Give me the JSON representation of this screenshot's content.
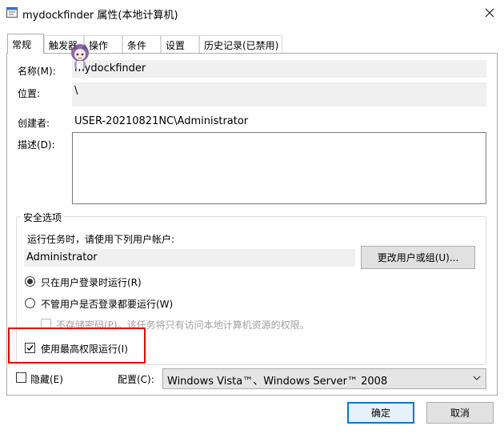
{
  "window": {
    "title": "mydockfinder 属性(本地计算机)",
    "close_glyph": "✕"
  },
  "tabs": [
    {
      "label": "常规",
      "active": true
    },
    {
      "label": "触发器",
      "active": false
    },
    {
      "label": "操作",
      "active": false
    },
    {
      "label": "条件",
      "active": false
    },
    {
      "label": "设置",
      "active": false
    },
    {
      "label": "历史记录(已禁用)",
      "active": false
    }
  ],
  "general": {
    "name_label": "名称(M):",
    "name_value": "mydockfinder",
    "location_label": "位置:",
    "location_value": "\\",
    "author_label": "创建者:",
    "author_value": "USER-20210821NC\\Administrator",
    "description_label": "描述(D):",
    "description_value": ""
  },
  "security": {
    "group_title": "安全选项",
    "run_as_label": "运行任务时，请使用下列用户帐户:",
    "user_account": "Administrator",
    "change_user_button": "更改用户或组(U)...",
    "radio_logged_on": "只在用户登录时运行(R)",
    "radio_logged_on_selected": true,
    "radio_whether_logged": "不管用户是否登录都要运行(W)",
    "radio_whether_logged_selected": false,
    "no_store_password": "不存储密码(P)。该任务将只有访问本地计算机资源的权限。",
    "highest_privileges": "使用最高权限运行(I)",
    "highest_privileges_checked": true
  },
  "bottom": {
    "hidden_label": "隐藏(E)",
    "hidden_checked": false,
    "configure_label": "配置(C):",
    "configure_value": "Windows Vista™、Windows Server™ 2008"
  },
  "buttons": {
    "ok": "确定",
    "cancel": "取消"
  },
  "colors": {
    "highlight_border": "#e60000",
    "default_button_border": "#0078d7"
  }
}
